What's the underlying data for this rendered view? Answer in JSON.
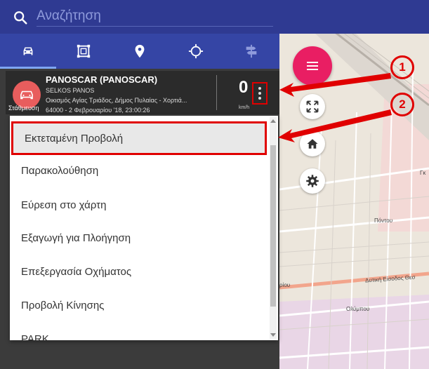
{
  "search": {
    "placeholder": "Αναζήτηση"
  },
  "tabs": [
    {
      "icon": "car-icon",
      "active": true
    },
    {
      "icon": "geofence-icon",
      "active": false
    },
    {
      "icon": "location-pin-icon",
      "active": false
    },
    {
      "icon": "crosshair-icon",
      "active": false
    },
    {
      "icon": "signpost-icon",
      "active": false
    }
  ],
  "vehicle": {
    "name": "PANOSCAR (PANOSCAR)",
    "driver": "SELKOS PANOS",
    "address": "Οικισμός Αγίας Τριάδος, Δήμος Πυλαίας - Χορτιά...",
    "time": "64000 - 2 Φεβρουαρίου '18, 23:00:26",
    "status": "Στάθμευση",
    "speed": "0",
    "speed_unit": "km/h",
    "status_color": "#e85d5d"
  },
  "menu": {
    "items": [
      "Εκτεταμένη Προβολή",
      "Παρακολούθηση",
      "Εύρεση στο χάρτη",
      "Εξαγωγή για Πλοήγηση",
      "Επεξεργασία Οχήματος",
      "Προβολή Κίνησης",
      "PARK"
    ]
  },
  "map": {
    "streets": [
      "Πόντου",
      "Δυτική Είσοδος Θεσ",
      "Ολύμπου",
      "ρίου",
      "Γκ"
    ]
  },
  "callouts": [
    "1",
    "2"
  ],
  "colors": {
    "topbar": "#2f3a92",
    "tabs": "#3545a5",
    "fab": "#e91e63",
    "annotation": "#e00000"
  }
}
